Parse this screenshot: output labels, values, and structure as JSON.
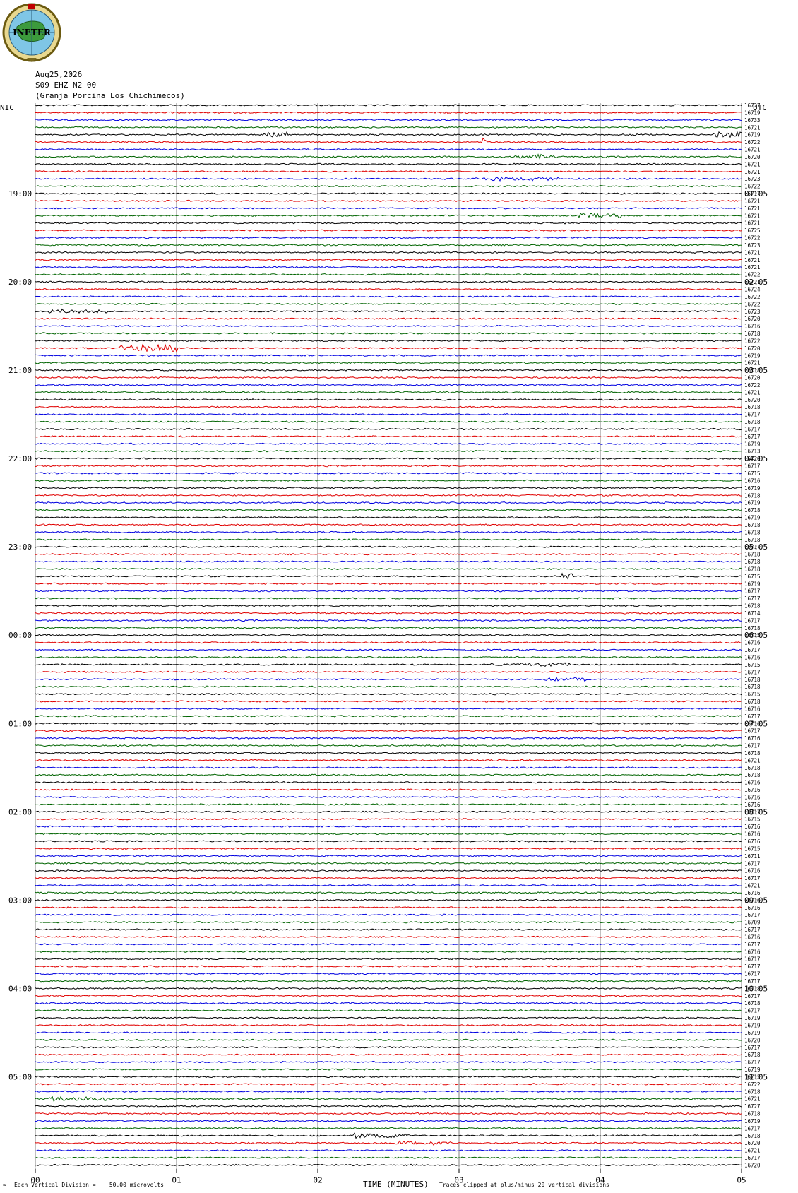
{
  "header": {
    "date": "Aug25,2026",
    "channel": "S09 EHZ N2 00",
    "station": "(Granja Porcina Los Chichimecos)",
    "left_label": "NIC",
    "right_label": "UTC"
  },
  "logo": {
    "text": "INETER"
  },
  "colors": {
    "trace_cycle": [
      "#000000",
      "#e00000",
      "#0000e0",
      "#006400"
    ]
  },
  "chart_data": {
    "type": "line",
    "title": "",
    "xlabel": "TIME (MINUTES)",
    "xlim": [
      0,
      5
    ],
    "x_ticks": [
      "00",
      "01",
      "02",
      "03",
      "04",
      "05"
    ],
    "trace_count": 145,
    "left_hour_labels": [
      "19:00",
      "20:00",
      "21:00",
      "22:00",
      "23:00",
      "00:00",
      "01:00",
      "02:00",
      "03:00",
      "04:00",
      "05:00"
    ],
    "right_hour_labels": [
      "01:05",
      "02:05",
      "03:05",
      "04:05",
      "05:05",
      "06:05",
      "07:05",
      "08:05",
      "09:05",
      "10:05",
      "11:05"
    ],
    "hour_label_first_trace": 12,
    "traces_per_hour": 12,
    "trace_values": [
      "16727",
      "16719",
      "16733",
      "16721",
      "16719",
      "16722",
      "16721",
      "16720",
      "16721",
      "16721",
      "16723",
      "16722",
      "16717",
      "16721",
      "16721",
      "16721",
      "16721",
      "16725",
      "16722",
      "16723",
      "16721",
      "16721",
      "16721",
      "16722",
      "16721",
      "16724",
      "16722",
      "16722",
      "16723",
      "16720",
      "16716",
      "16718",
      "16722",
      "16720",
      "16719",
      "16721",
      "16718",
      "16720",
      "16722",
      "16721",
      "16720",
      "16718",
      "16717",
      "16718",
      "16717",
      "16717",
      "16719",
      "16713",
      "16720",
      "16717",
      "16715",
      "16716",
      "16719",
      "16718",
      "16719",
      "16718",
      "16719",
      "16718",
      "16718",
      "16718",
      "16717",
      "16718",
      "16718",
      "16718",
      "16715",
      "16719",
      "16717",
      "16717",
      "16718",
      "16714",
      "16717",
      "16718",
      "16715",
      "16716",
      "16717",
      "16716",
      "16715",
      "16717",
      "16718",
      "16718",
      "16715",
      "16718",
      "16716",
      "16717",
      "16716",
      "16717",
      "16716",
      "16717",
      "16718",
      "16721",
      "16718",
      "16718",
      "16716",
      "16716",
      "16716",
      "16716",
      "16717",
      "16715",
      "16716",
      "16716",
      "16716",
      "16715",
      "16711",
      "16717",
      "16716",
      "16717",
      "16721",
      "16716",
      "16716",
      "16716",
      "16717",
      "16709",
      "16717",
      "16716",
      "16717",
      "16716",
      "16717",
      "16717",
      "16717",
      "16717",
      "16718",
      "16717",
      "16718",
      "16717",
      "16719",
      "16719",
      "16719",
      "16720",
      "16717",
      "16718",
      "16717",
      "16719",
      "16715",
      "16722",
      "16718",
      "16721",
      "16727",
      "16718",
      "16719",
      "16717",
      "16718",
      "16720",
      "16721",
      "16717",
      "16720"
    ],
    "events": [
      {
        "trace": 4,
        "minute": 1.62,
        "duration": 0.2,
        "amplitude": 6
      },
      {
        "trace": 4,
        "minute": 4.8,
        "duration": 0.2,
        "amplitude": 5
      },
      {
        "trace": 5,
        "minute": 3.16,
        "duration": 0.04,
        "amplitude": 7
      },
      {
        "trace": 7,
        "minute": 3.4,
        "duration": 0.3,
        "amplitude": 4
      },
      {
        "trace": 10,
        "minute": 3.1,
        "duration": 0.6,
        "amplitude": 3
      },
      {
        "trace": 15,
        "minute": 3.85,
        "duration": 0.3,
        "amplitude": 4
      },
      {
        "trace": 28,
        "minute": 0.1,
        "duration": 0.4,
        "amplitude": 4
      },
      {
        "trace": 33,
        "minute": 0.6,
        "duration": 0.4,
        "amplitude": 6
      },
      {
        "trace": 64,
        "minute": 3.72,
        "duration": 0.08,
        "amplitude": 5
      },
      {
        "trace": 76,
        "minute": 3.2,
        "duration": 0.6,
        "amplitude": 3
      },
      {
        "trace": 78,
        "minute": 3.6,
        "duration": 0.3,
        "amplitude": 3
      },
      {
        "trace": 135,
        "minute": 0.1,
        "duration": 0.4,
        "amplitude": 4
      },
      {
        "trace": 140,
        "minute": 2.25,
        "duration": 0.4,
        "amplitude": 5
      },
      {
        "trace": 141,
        "minute": 2.55,
        "duration": 0.4,
        "amplitude": 4
      }
    ]
  },
  "footer": {
    "vertical_division": "Each Vertical Division =    50.00 microvolts",
    "clip_note": "Traces clipped at plus/minus 20 vertical divisions",
    "tiny_mark": "≈"
  }
}
